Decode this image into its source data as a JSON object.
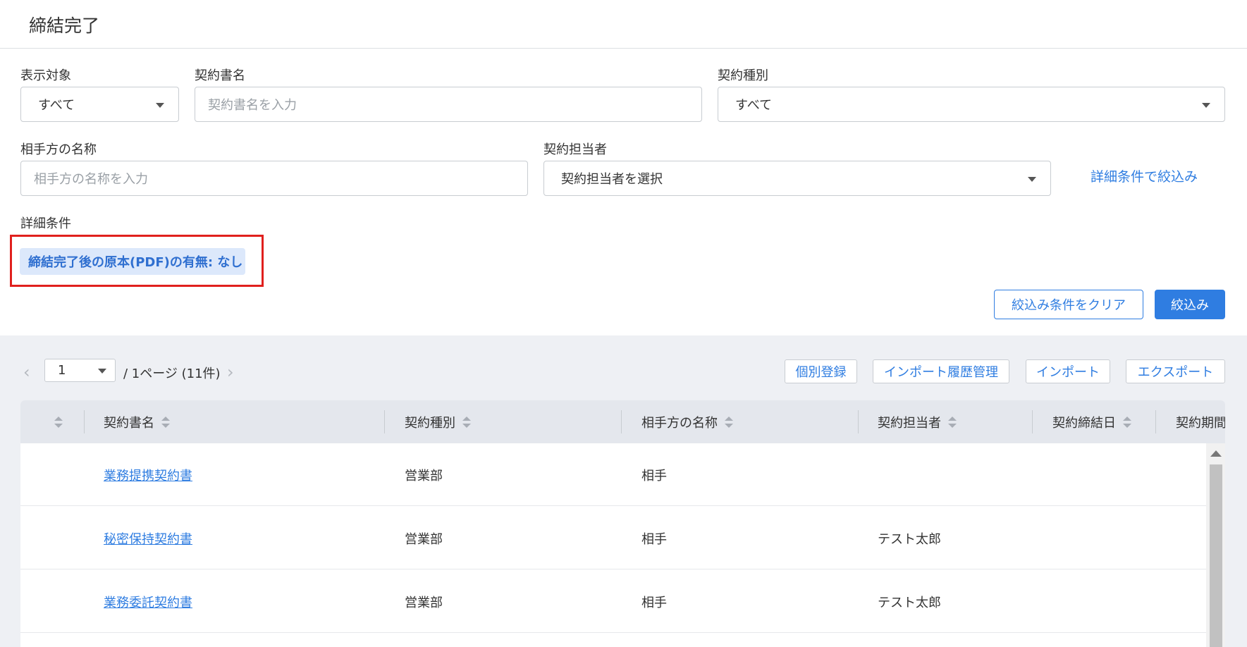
{
  "header": {
    "title": "締結完了"
  },
  "filters": {
    "display_target": {
      "label": "表示対象",
      "value": "すべて"
    },
    "contract_name": {
      "label": "契約書名",
      "placeholder": "契約書名を入力"
    },
    "contract_type": {
      "label": "契約種別",
      "value": "すべて"
    },
    "counterparty": {
      "label": "相手方の名称",
      "placeholder": "相手方の名称を入力"
    },
    "owner": {
      "label": "契約担当者",
      "value": "契約担当者を選択"
    },
    "advanced_link": "詳細条件で絞込み",
    "advanced": {
      "label": "詳細条件",
      "chip": "締結完了後の原本(PDF)の有無: なし"
    },
    "clear_button": "絞込み条件をクリア",
    "apply_button": "絞込み"
  },
  "pager": {
    "current_page": "1",
    "info": "/ 1ページ (11件)"
  },
  "toolbar": {
    "individual_register": "個別登録",
    "import_history": "インポート履歴管理",
    "import": "インポート",
    "export": "エクスポート"
  },
  "table": {
    "columns": [
      "契約書名",
      "契約種別",
      "相手方の名称",
      "契約担当者",
      "契約締結日",
      "契約期間"
    ],
    "rows": [
      {
        "name": "業務提携契約書",
        "type": "営業部",
        "counterparty": "相手",
        "owner": ""
      },
      {
        "name": "秘密保持契約書",
        "type": "営業部",
        "counterparty": "相手",
        "owner": "テスト太郎"
      },
      {
        "name": "業務委託契約書",
        "type": "営業部",
        "counterparty": "相手",
        "owner": "テスト太郎"
      }
    ]
  },
  "colors": {
    "accent": "#2f7de1",
    "highlight": "#e0201d",
    "chip_bg": "#dce8fb"
  }
}
